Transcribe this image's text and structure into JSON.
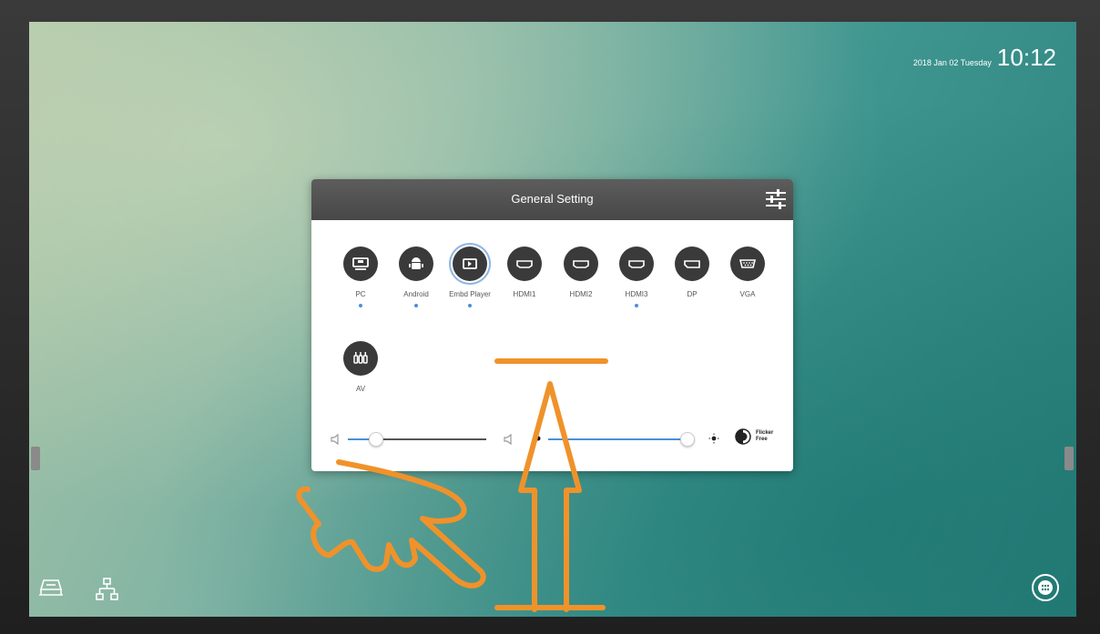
{
  "status": {
    "date": "2018 Jan 02 Tuesday",
    "time": "10:12"
  },
  "panel": {
    "title": "General Setting",
    "sources": [
      {
        "label": "PC",
        "icon": "pc-icon",
        "indicator": true
      },
      {
        "label": "Android",
        "icon": "android-icon",
        "indicator": true
      },
      {
        "label": "Embd Player",
        "icon": "embedded-player-icon",
        "indicator": true,
        "selected": true
      },
      {
        "label": "HDMI1",
        "icon": "hdmi-icon",
        "indicator": false
      },
      {
        "label": "HDMI2",
        "icon": "hdmi-icon",
        "indicator": false
      },
      {
        "label": "HDMI3",
        "icon": "hdmi-icon",
        "indicator": true
      },
      {
        "label": "DP",
        "icon": "displayport-icon",
        "indicator": false
      },
      {
        "label": "VGA",
        "icon": "vga-icon",
        "indicator": false
      },
      {
        "label": "AV",
        "icon": "av-icon",
        "indicator": false
      }
    ],
    "volume": {
      "value": 0.2
    },
    "brightness": {
      "value": 0.95
    },
    "flicker_free": {
      "label": "Flicker Free"
    }
  },
  "colors": {
    "accent": "#4a90d9",
    "header_bg": "#4f4f4f",
    "annotation": "#f0922a"
  }
}
